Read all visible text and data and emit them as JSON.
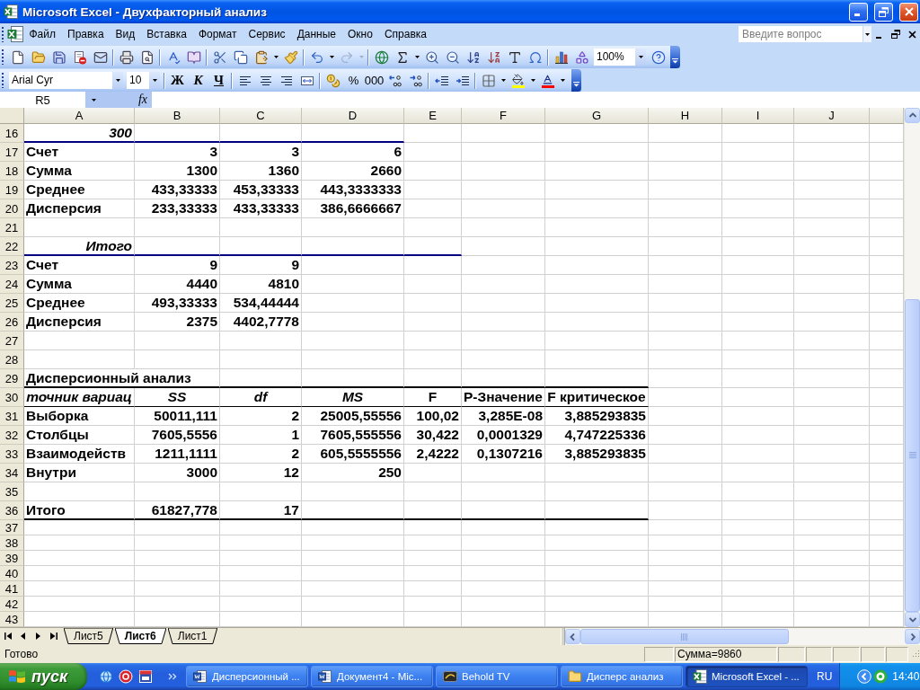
{
  "window": {
    "title": "Microsoft Excel - Двухфакторный анализ"
  },
  "menu_bar": {
    "items": [
      "Файл",
      "Правка",
      "Вид",
      "Вставка",
      "Формат",
      "Сервис",
      "Данные",
      "Окно",
      "Справка"
    ],
    "help_search": {
      "placeholder": "Введите вопрос"
    }
  },
  "standard_toolbar": {
    "redo": {
      "disabled": true
    },
    "zoom": "100%"
  },
  "formatting_toolbar": {
    "font": "Arial Cyr",
    "size": "10",
    "style_buttons": [
      {
        "label": "Ж",
        "kind": "bold"
      },
      {
        "label": "К",
        "kind": "italic"
      },
      {
        "label": "Ч",
        "kind": "underline"
      }
    ],
    "number_buttons": [
      "%",
      "000"
    ]
  },
  "formula_bar": {
    "name_box": "R5",
    "function_button": "fx"
  },
  "sheet": {
    "columns": [
      "A",
      "B",
      "C",
      "D",
      "E",
      "F",
      "G",
      "H",
      "I",
      "J"
    ],
    "rows": [
      {
        "number": "16",
        "cells": [
          {
            "text": "300",
            "kind": "group"
          }
        ]
      },
      {
        "number": "17",
        "cells": [
          {
            "text": "Счет",
            "kind": "label"
          },
          {
            "text": "3",
            "kind": "number"
          },
          {
            "text": "3",
            "kind": "number"
          },
          {
            "text": "6",
            "kind": "number"
          }
        ]
      },
      {
        "number": "18",
        "cells": [
          {
            "text": "Сумма",
            "kind": "label"
          },
          {
            "text": "1300",
            "kind": "number"
          },
          {
            "text": "1360",
            "kind": "number"
          },
          {
            "text": "2660",
            "kind": "number"
          }
        ]
      },
      {
        "number": "19",
        "cells": [
          {
            "text": "Среднее",
            "kind": "label"
          },
          {
            "text": "433,33333",
            "kind": "number"
          },
          {
            "text": "453,33333",
            "kind": "number"
          },
          {
            "text": "443,3333333",
            "kind": "number"
          }
        ]
      },
      {
        "number": "20",
        "cells": [
          {
            "text": "Дисперсия",
            "kind": "label"
          },
          {
            "text": "233,33333",
            "kind": "number"
          },
          {
            "text": "433,33333",
            "kind": "number"
          },
          {
            "text": "386,6666667",
            "kind": "number"
          }
        ]
      },
      {
        "number": "21"
      },
      {
        "number": "22",
        "cells": [
          {
            "text": "Итого",
            "kind": "group"
          }
        ]
      },
      {
        "number": "23",
        "cells": [
          {
            "text": "Счет",
            "kind": "label"
          },
          {
            "text": "9",
            "kind": "number"
          },
          {
            "text": "9",
            "kind": "number"
          }
        ]
      },
      {
        "number": "24",
        "cells": [
          {
            "text": "Сумма",
            "kind": "label"
          },
          {
            "text": "4440",
            "kind": "number"
          },
          {
            "text": "4810",
            "kind": "number"
          }
        ]
      },
      {
        "number": "25",
        "cells": [
          {
            "text": "Среднее",
            "kind": "label"
          },
          {
            "text": "493,33333",
            "kind": "number"
          },
          {
            "text": "534,44444",
            "kind": "number"
          }
        ]
      },
      {
        "number": "26",
        "cells": [
          {
            "text": "Дисперсия",
            "kind": "label"
          },
          {
            "text": "2375",
            "kind": "number"
          },
          {
            "text": "4402,7778",
            "kind": "number"
          }
        ]
      },
      {
        "number": "27"
      },
      {
        "number": "28"
      },
      {
        "number": "29",
        "cells": [
          {
            "text": "Дисперсионный анализ",
            "kind": "title"
          }
        ]
      },
      {
        "number": "30",
        "cells": [
          {
            "text": "точник вариац",
            "kind": "head"
          },
          {
            "text": "SS",
            "kind": "head"
          },
          {
            "text": "df",
            "kind": "head"
          },
          {
            "text": "MS",
            "kind": "head"
          },
          {
            "text": "F",
            "kind": "stat"
          },
          {
            "text": "P-Значение",
            "kind": "stat"
          },
          {
            "text": "F критическое",
            "kind": "stat"
          }
        ]
      },
      {
        "number": "31",
        "cells": [
          {
            "text": "Выборка",
            "kind": "label"
          },
          {
            "text": "50011,111",
            "kind": "number"
          },
          {
            "text": "2",
            "kind": "number"
          },
          {
            "text": "25005,55556",
            "kind": "number"
          },
          {
            "text": "100,02",
            "kind": "number"
          },
          {
            "text": "3,285E-08",
            "kind": "number"
          },
          {
            "text": "3,885293835",
            "kind": "number"
          }
        ]
      },
      {
        "number": "32",
        "cells": [
          {
            "text": "Столбцы",
            "kind": "label"
          },
          {
            "text": "7605,5556",
            "kind": "number"
          },
          {
            "text": "1",
            "kind": "number"
          },
          {
            "text": "7605,555556",
            "kind": "number"
          },
          {
            "text": "30,422",
            "kind": "number"
          },
          {
            "text": "0,0001329",
            "kind": "number"
          },
          {
            "text": "4,747225336",
            "kind": "number"
          }
        ]
      },
      {
        "number": "33",
        "cells": [
          {
            "text": "Взаимодейств",
            "kind": "label"
          },
          {
            "text": "1211,1111",
            "kind": "number"
          },
          {
            "text": "2",
            "kind": "number"
          },
          {
            "text": "605,5555556",
            "kind": "number"
          },
          {
            "text": "2,4222",
            "kind": "number"
          },
          {
            "text": "0,1307216",
            "kind": "number"
          },
          {
            "text": "3,885293835",
            "kind": "number"
          }
        ]
      },
      {
        "number": "34",
        "cells": [
          {
            "text": "Внутри",
            "kind": "label"
          },
          {
            "text": "3000",
            "kind": "number"
          },
          {
            "text": "12",
            "kind": "number"
          },
          {
            "text": "250",
            "kind": "number"
          }
        ]
      },
      {
        "number": "35"
      },
      {
        "number": "36",
        "cells": [
          {
            "text": "Итого",
            "kind": "label"
          },
          {
            "text": "61827,778",
            "kind": "number"
          },
          {
            "text": "17",
            "kind": "number"
          }
        ]
      },
      {
        "number": "37"
      },
      {
        "number": "38"
      },
      {
        "number": "39"
      },
      {
        "number": "40"
      },
      {
        "number": "41"
      },
      {
        "number": "42"
      },
      {
        "number": "43"
      }
    ]
  },
  "sheet_tabs": [
    {
      "label": "Лист5",
      "selected": false
    },
    {
      "label": "Лист6",
      "selected": true
    },
    {
      "label": "Лист1",
      "selected": false
    }
  ],
  "status_bar": {
    "status": "Готово",
    "sum": "Сумма=9860"
  },
  "taskbar": {
    "start": "пуск",
    "windows": [
      {
        "label": "Дисперсионный ...",
        "kind": "word",
        "selected": false
      },
      {
        "label": "Документ4 - Mic...",
        "kind": "word",
        "selected": false
      },
      {
        "label": "Behold TV",
        "kind": "tv",
        "selected": false
      },
      {
        "label": "Дисперс анализ",
        "kind": "folder",
        "selected": false
      },
      {
        "label": "Microsoft Excel - ...",
        "kind": "excel",
        "selected": true
      }
    ],
    "language": "RU",
    "clock": "14:40"
  }
}
